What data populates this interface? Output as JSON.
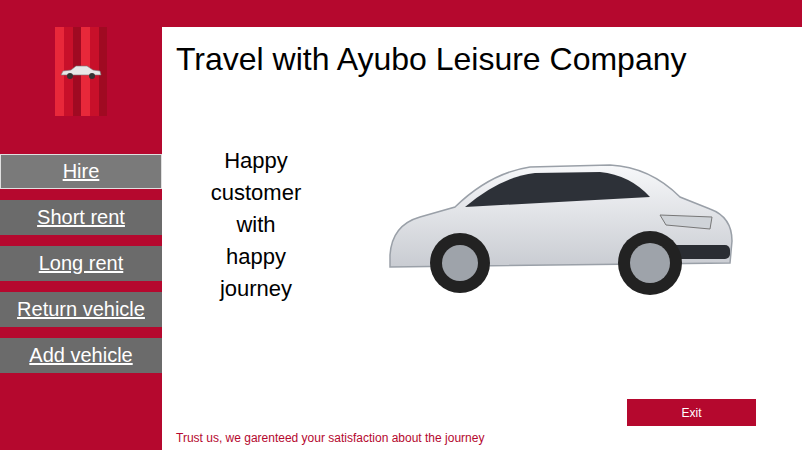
{
  "title": "Travel with Ayubo Leisure Company",
  "slogan": "Happy customer with happy journey",
  "sidebar": {
    "items": [
      {
        "label": "Hire",
        "selected": true
      },
      {
        "label": "Short rent",
        "selected": false
      },
      {
        "label": "Long rent",
        "selected": false
      },
      {
        "label": "Return vehicle",
        "selected": false
      },
      {
        "label": "Add vehicle",
        "selected": false
      }
    ]
  },
  "buttons": [
    "Exit"
  ],
  "footer": "Trust us, we garenteed your satisfaction about the journey"
}
